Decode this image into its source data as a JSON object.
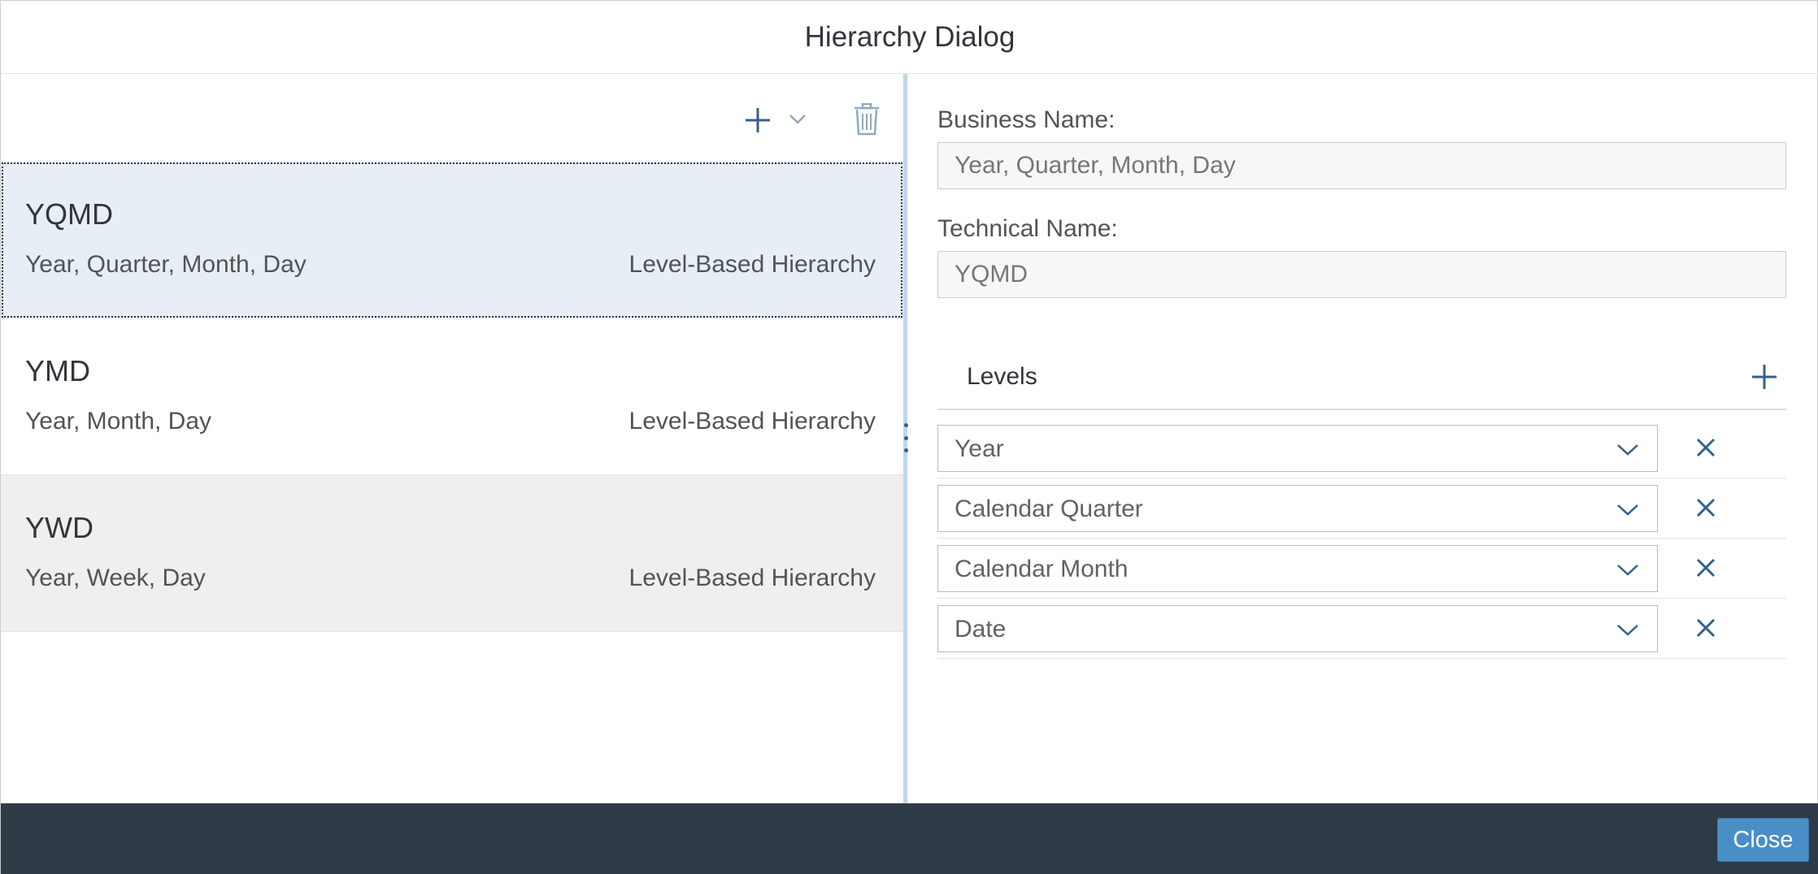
{
  "dialog": {
    "title": "Hierarchy Dialog"
  },
  "toolbar": {
    "add_icon": "plus-icon",
    "dropdown_icon": "chevron-down-icon",
    "delete_icon": "trash-icon"
  },
  "hierarchies": [
    {
      "name": "YQMD",
      "description": "Year, Quarter, Month, Day",
      "type": "Level-Based Hierarchy",
      "state": "selected"
    },
    {
      "name": "YMD",
      "description": "Year, Month, Day",
      "type": "Level-Based Hierarchy",
      "state": "normal"
    },
    {
      "name": "YWD",
      "description": "Year, Week, Day",
      "type": "Level-Based Hierarchy",
      "state": "hover"
    }
  ],
  "details": {
    "business_name_label": "Business Name:",
    "business_name_value": "Year, Quarter, Month, Day",
    "technical_name_label": "Technical Name:",
    "technical_name_value": "YQMD",
    "levels_title": "Levels",
    "levels": [
      {
        "value": "Year"
      },
      {
        "value": "Calendar Quarter"
      },
      {
        "value": "Calendar Month"
      },
      {
        "value": "Date"
      }
    ]
  },
  "footer": {
    "close_label": "Close"
  },
  "colors": {
    "accent": "#346187",
    "selected_row": "#e7eef6",
    "footer_bg": "#2e3a46",
    "button_bg": "#4a8ec7"
  }
}
